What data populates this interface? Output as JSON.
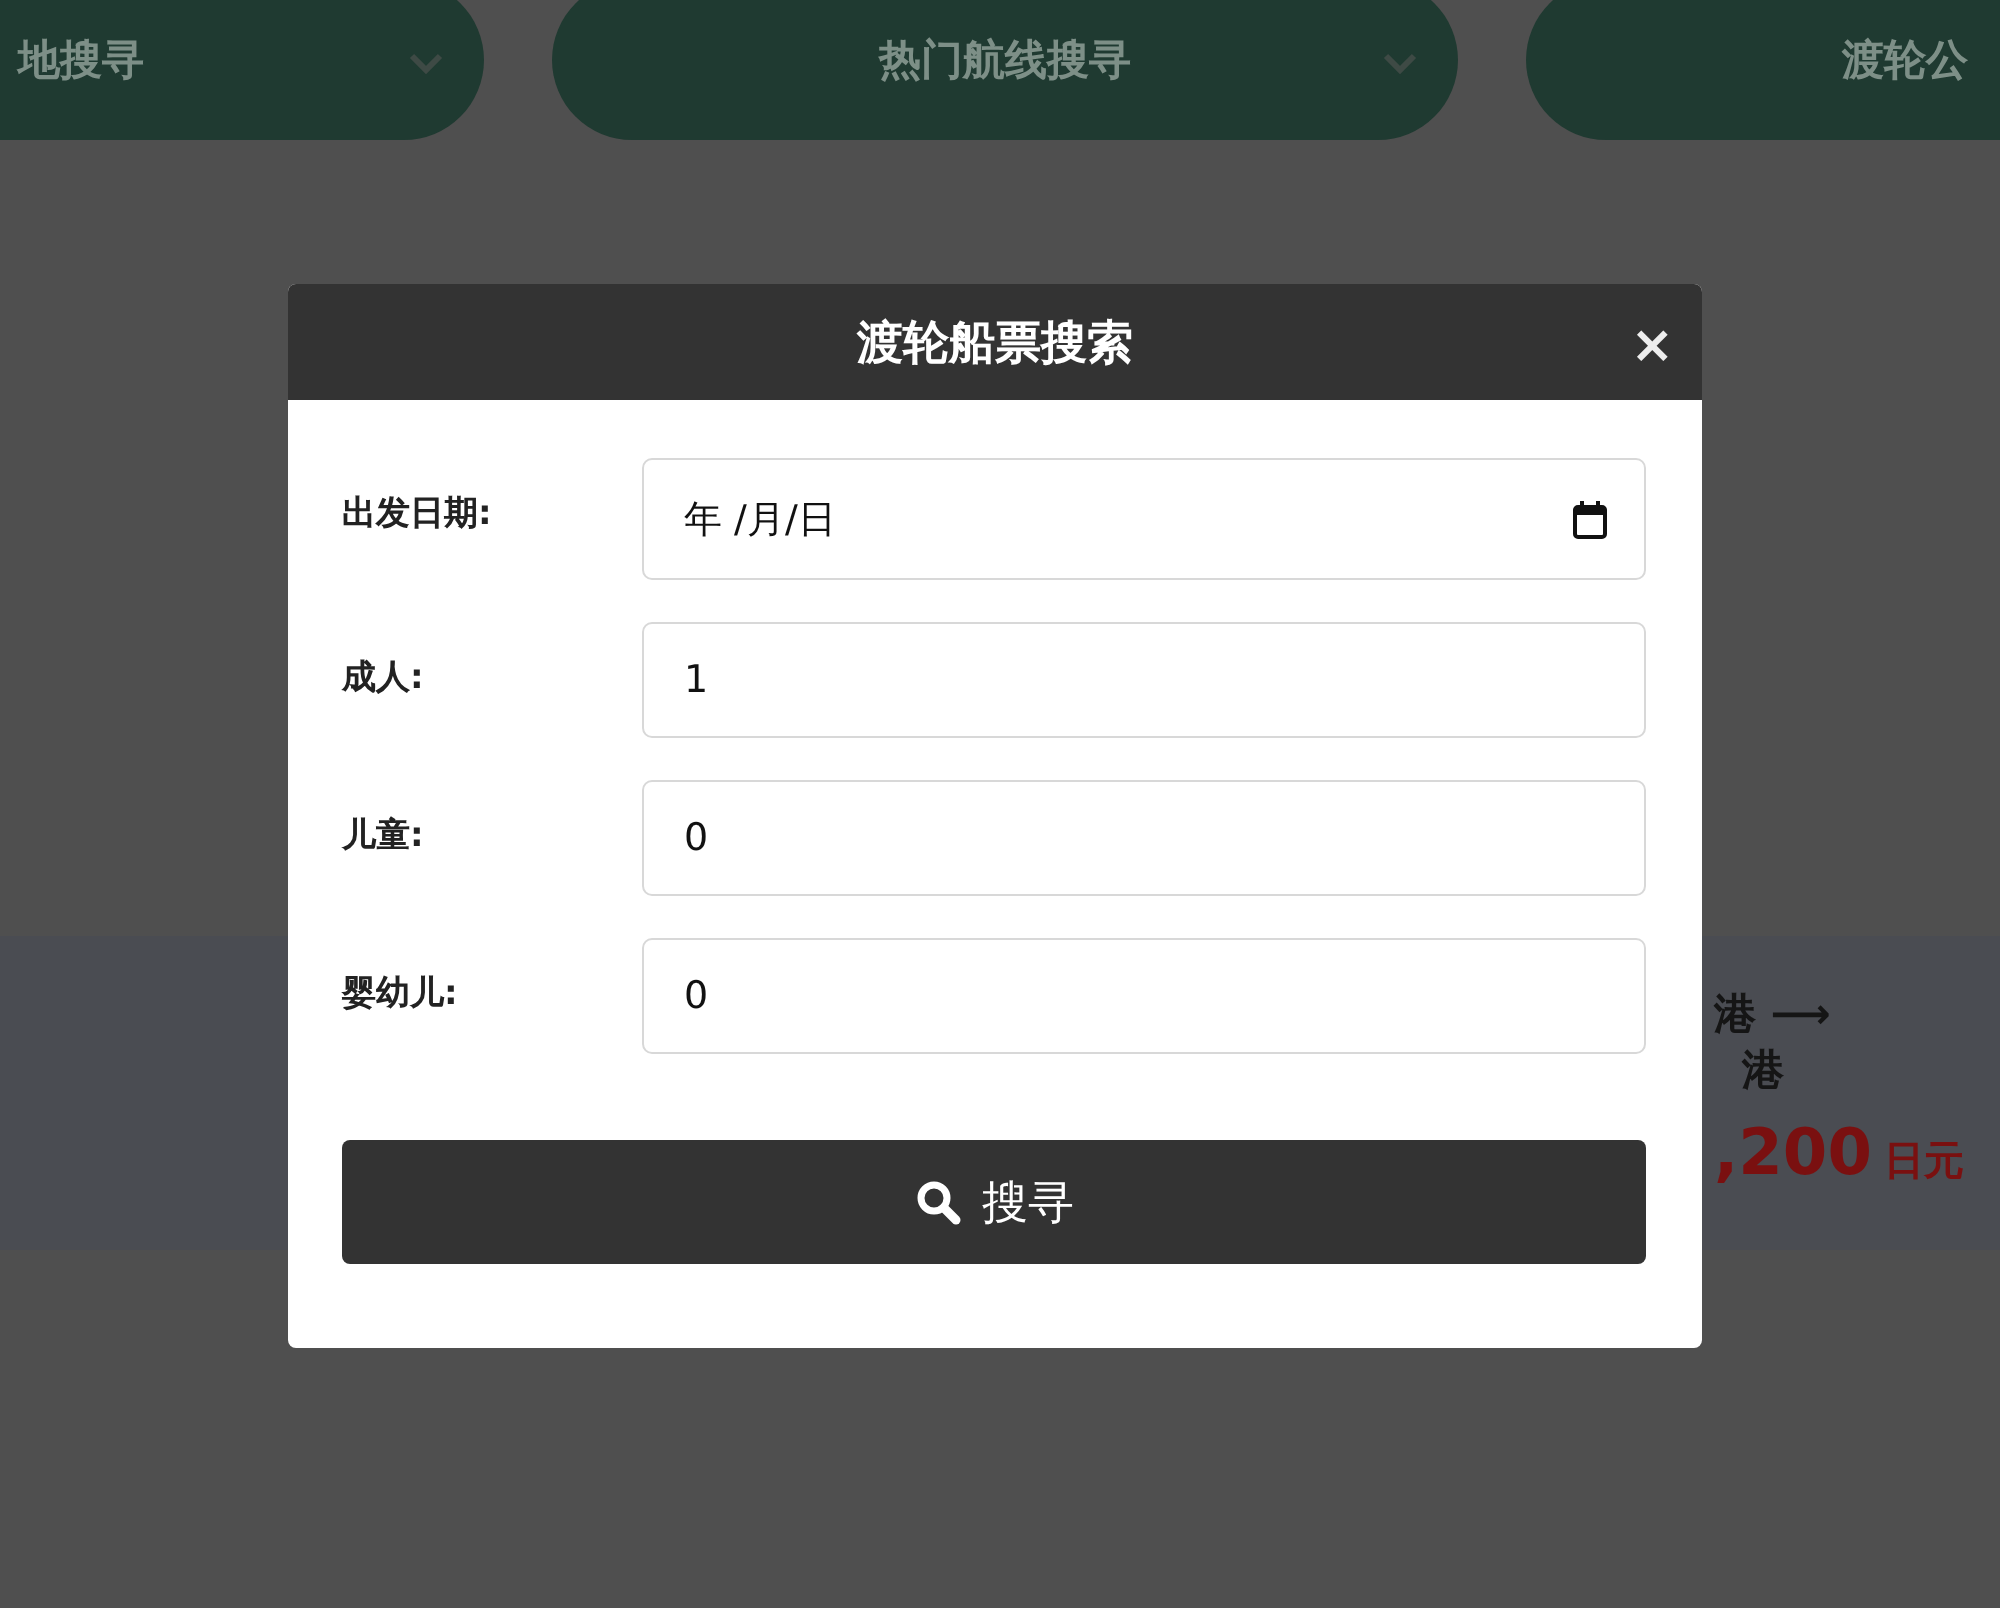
{
  "background": {
    "tabs": [
      {
        "label": "地搜寻",
        "dropdown": true
      },
      {
        "label": "热门航线搜寻",
        "dropdown": true
      },
      {
        "label": "渡轮公"
      }
    ],
    "route_card": {
      "from": "港 ⟶",
      "to": "港",
      "price": ",200",
      "unit": "日元"
    }
  },
  "dialog": {
    "title": "渡轮船票搜索",
    "close": "×",
    "fields": [
      {
        "label": "出发日期:",
        "kind": "date",
        "value": "年 /月/日"
      },
      {
        "label": "成人:",
        "kind": "number",
        "value": "1"
      },
      {
        "label": "儿童:",
        "kind": "number",
        "value": "0"
      },
      {
        "label": "婴幼儿:",
        "kind": "number",
        "value": "0"
      }
    ],
    "button": "搜寻"
  }
}
